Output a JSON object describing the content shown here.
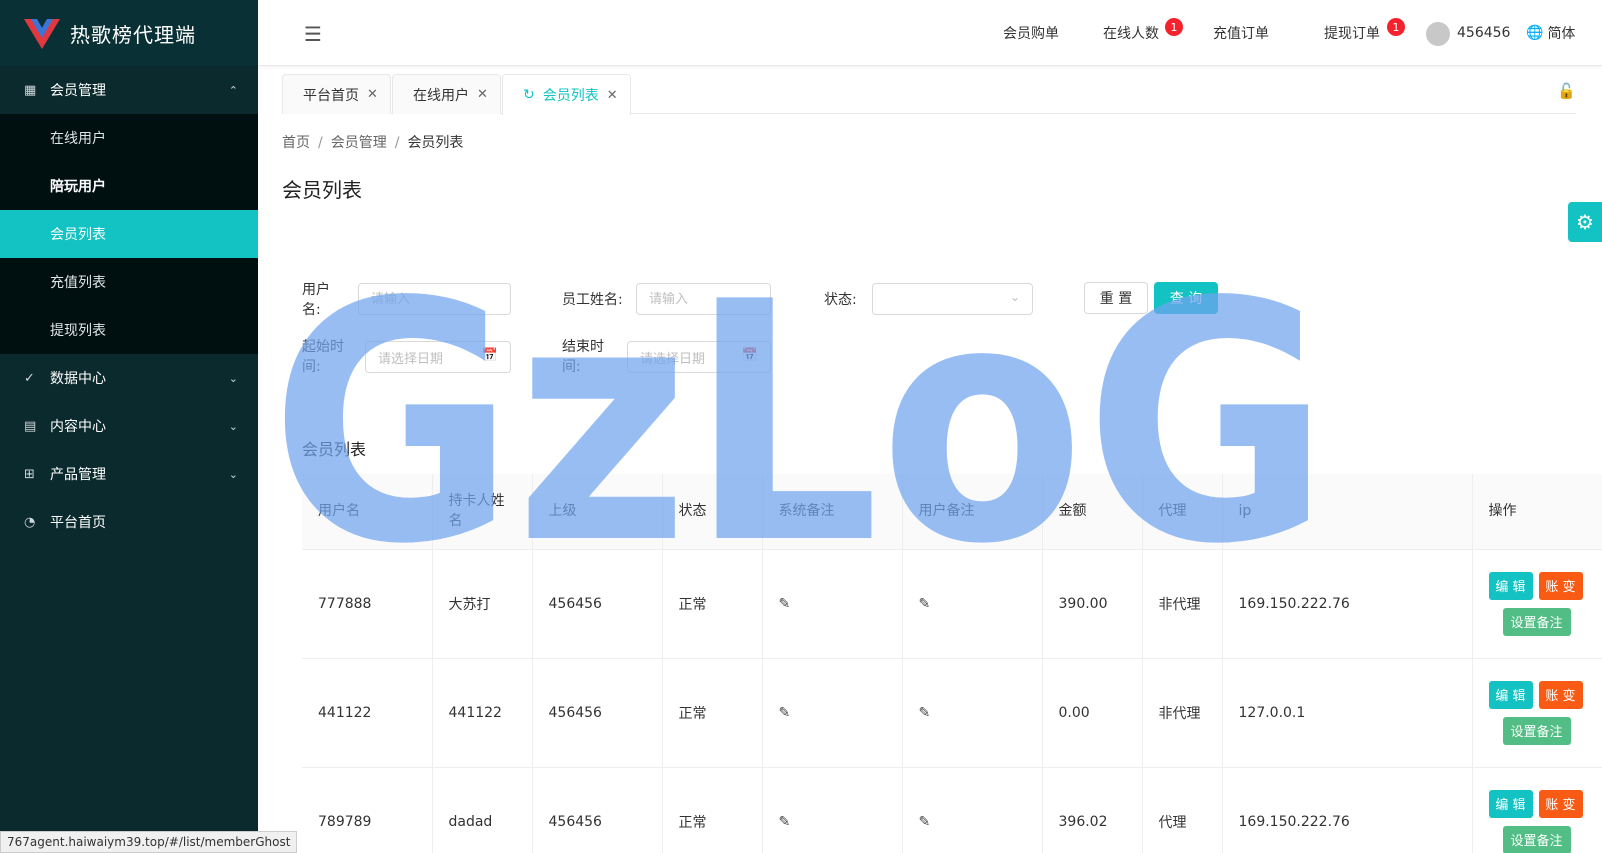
{
  "app": {
    "title": "热歌榜代理端"
  },
  "sidebar": {
    "groups": [
      {
        "label": "会员管理",
        "icon": "table-icon",
        "expanded": true,
        "items": [
          {
            "label": "在线用户"
          },
          {
            "label": "陪玩用户"
          },
          {
            "label": "会员列表",
            "active": true
          },
          {
            "label": "充值列表"
          },
          {
            "label": "提现列表"
          }
        ]
      },
      {
        "label": "数据中心",
        "icon": "check-circle-icon"
      },
      {
        "label": "内容中心",
        "icon": "document-icon"
      },
      {
        "label": "产品管理",
        "icon": "grid-icon"
      },
      {
        "label": "平台首页",
        "icon": "dashboard-icon"
      }
    ]
  },
  "header": {
    "nav": [
      {
        "label": "会员购单"
      },
      {
        "label": "在线人数",
        "badge": "1"
      },
      {
        "label": "充值订单"
      },
      {
        "label": "提现订单",
        "badge": "1"
      }
    ],
    "username": "456456",
    "language": "简体"
  },
  "tabs": [
    {
      "label": "平台首页"
    },
    {
      "label": "在线用户"
    },
    {
      "label": "会员列表",
      "active": true
    }
  ],
  "breadcrumb": [
    "首页",
    "会员管理",
    "会员列表"
  ],
  "page_title": "会员列表",
  "filters": {
    "username_label_1": "用户",
    "username_label_2": "名:",
    "username_placeholder": "请输入",
    "staff_label": "员工姓名:",
    "staff_placeholder": "请输入",
    "status_label": "状态:",
    "start_label_1": "起始时",
    "start_label_2": "间:",
    "start_placeholder": "请选择日期",
    "end_label_1": "结束时",
    "end_label_2": "间:",
    "end_placeholder": "请选择日期",
    "reset": "重 置",
    "query": "查 询"
  },
  "section_title": "会员列表",
  "table": {
    "columns": [
      "用户名",
      "持卡人姓名",
      "上级",
      "状态",
      "系统备注",
      "用户备注",
      "金额",
      "代理",
      "ip",
      "操作"
    ],
    "rows": [
      {
        "username": "777888",
        "cardholder": "大苏打",
        "parent": "456456",
        "status": "正常",
        "amount": "390.00",
        "agent": "非代理",
        "ip": "169.150.222.76"
      },
      {
        "username": "441122",
        "cardholder": "441122",
        "parent": "456456",
        "status": "正常",
        "amount": "0.00",
        "agent": "非代理",
        "ip": "127.0.0.1"
      },
      {
        "username": "789789",
        "cardholder": "dadad",
        "parent": "456456",
        "status": "正常",
        "amount": "396.02",
        "agent": "代理",
        "ip": "169.150.222.76"
      }
    ],
    "actions": {
      "edit": "编 辑",
      "account": "账 变",
      "note": "设置备注"
    }
  },
  "watermark": "GzLoG",
  "statusbar": "767agent.haiwaiym39.top/#/list/memberGhost",
  "colors": {
    "accent": "#13c2c2",
    "sidebar": "#0b2a2e",
    "danger": "#fa5b14",
    "success": "#52bd84",
    "watermark": "#6fa4ee"
  }
}
